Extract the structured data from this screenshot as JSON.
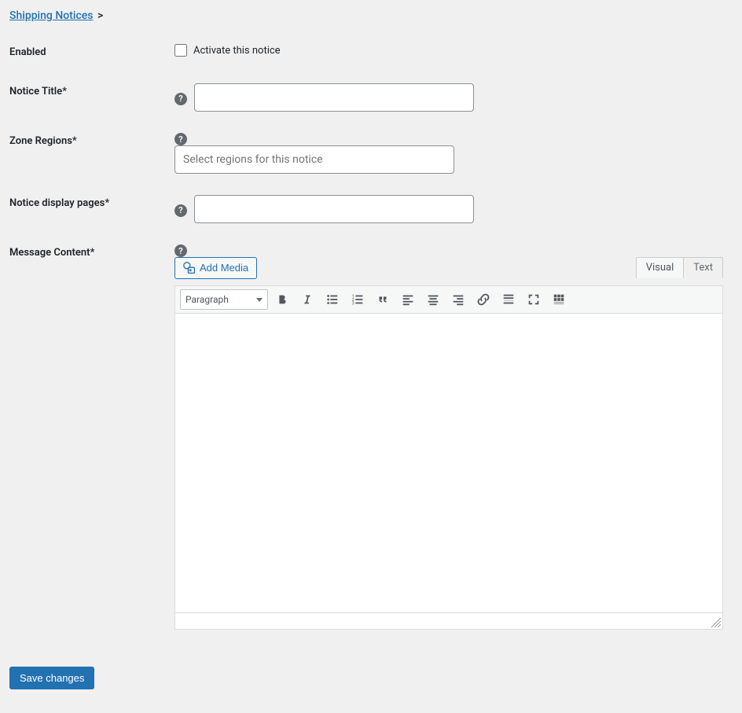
{
  "breadcrumb": {
    "label": "Shipping Notices",
    "sep": ">"
  },
  "fields": {
    "enabled": {
      "label": "Enabled",
      "checkbox_label": "Activate this notice"
    },
    "title": {
      "label": "Notice Title*",
      "value": ""
    },
    "zones": {
      "label": "Zone Regions*",
      "placeholder": "Select regions for this notice"
    },
    "pages": {
      "label": "Notice display pages*",
      "value": ""
    },
    "message": {
      "label": "Message Content*"
    }
  },
  "editor": {
    "add_media": "Add Media",
    "format": "Paragraph",
    "tabs": {
      "visual": "Visual",
      "text": "Text"
    }
  },
  "submit": {
    "label": "Save changes"
  }
}
